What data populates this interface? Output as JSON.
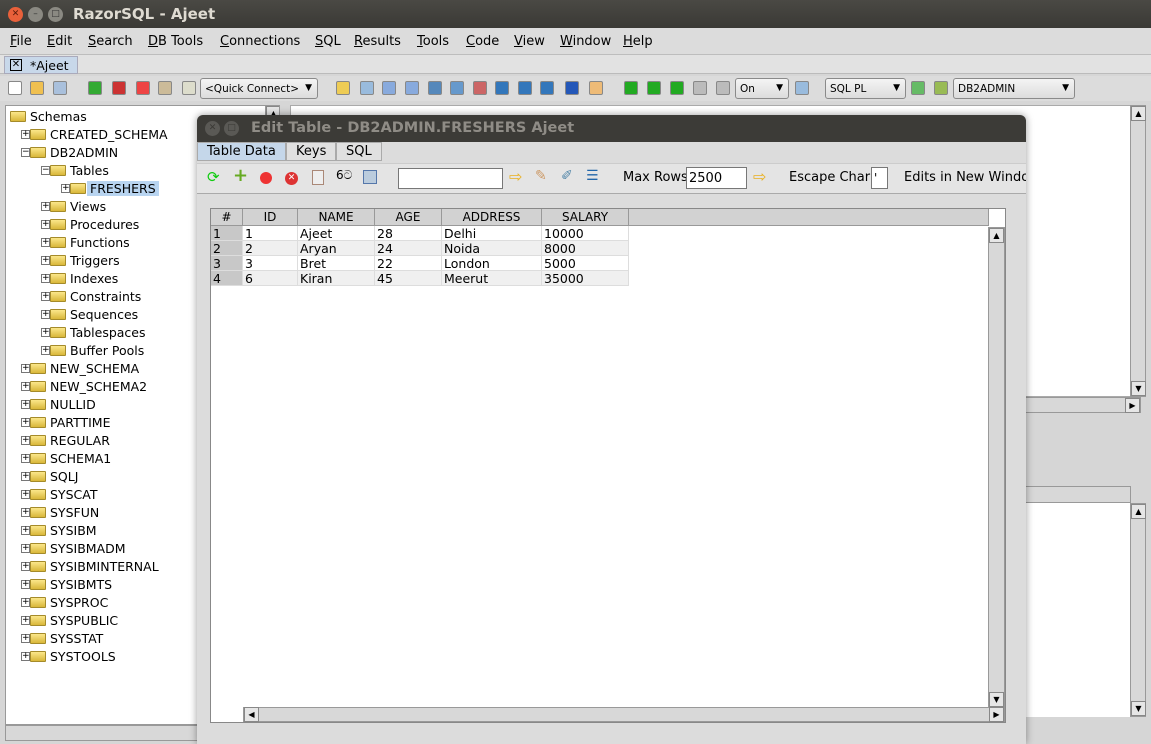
{
  "window": {
    "title": "RazorSQL - Ajeet"
  },
  "menu": [
    "File",
    "Edit",
    "Search",
    "DB Tools",
    "Connections",
    "SQL",
    "Results",
    "Tools",
    "Code",
    "View",
    "Window",
    "Help"
  ],
  "tab": {
    "label": "*Ajeet"
  },
  "toolbar": {
    "quick_connect": "<Quick Connect>",
    "autocommit": "On",
    "language": "SQL PL",
    "schema": "DB2ADMIN"
  },
  "tree": {
    "root": "Schemas",
    "items": [
      {
        "label": "CREATED_SCHEMA",
        "level": 1,
        "expanded": false
      },
      {
        "label": "DB2ADMIN",
        "level": 1,
        "expanded": true
      },
      {
        "label": "Tables",
        "level": 2,
        "expanded": true
      },
      {
        "label": "FRESHERS",
        "level": 3,
        "expanded": false,
        "selected": true
      },
      {
        "label": "Views",
        "level": 2,
        "expanded": false
      },
      {
        "label": "Procedures",
        "level": 2,
        "expanded": false
      },
      {
        "label": "Functions",
        "level": 2,
        "expanded": false
      },
      {
        "label": "Triggers",
        "level": 2,
        "expanded": false
      },
      {
        "label": "Indexes",
        "level": 2,
        "expanded": false
      },
      {
        "label": "Constraints",
        "level": 2,
        "expanded": false
      },
      {
        "label": "Sequences",
        "level": 2,
        "expanded": false
      },
      {
        "label": "Tablespaces",
        "level": 2,
        "expanded": false
      },
      {
        "label": "Buffer Pools",
        "level": 2,
        "expanded": false
      },
      {
        "label": "NEW_SCHEMA",
        "level": 1,
        "expanded": false
      },
      {
        "label": "NEW_SCHEMA2",
        "level": 1,
        "expanded": false
      },
      {
        "label": "NULLID",
        "level": 1,
        "expanded": false
      },
      {
        "label": "PARTTIME",
        "level": 1,
        "expanded": false
      },
      {
        "label": "REGULAR",
        "level": 1,
        "expanded": false
      },
      {
        "label": "SCHEMA1",
        "level": 1,
        "expanded": false
      },
      {
        "label": "SQLJ",
        "level": 1,
        "expanded": false
      },
      {
        "label": "SYSCAT",
        "level": 1,
        "expanded": false
      },
      {
        "label": "SYSFUN",
        "level": 1,
        "expanded": false
      },
      {
        "label": "SYSIBM",
        "level": 1,
        "expanded": false
      },
      {
        "label": "SYSIBMADM",
        "level": 1,
        "expanded": false
      },
      {
        "label": "SYSIBMINTERNAL",
        "level": 1,
        "expanded": false
      },
      {
        "label": "SYSIBMTS",
        "level": 1,
        "expanded": false
      },
      {
        "label": "SYSPROC",
        "level": 1,
        "expanded": false
      },
      {
        "label": "SYSPUBLIC",
        "level": 1,
        "expanded": false
      },
      {
        "label": "SYSSTAT",
        "level": 1,
        "expanded": false
      },
      {
        "label": "SYSTOOLS",
        "level": 1,
        "expanded": false
      }
    ]
  },
  "dialog": {
    "title": "Edit Table - DB2ADMIN.FRESHERS Ajeet",
    "tabs": [
      "Table Data",
      "Keys",
      "SQL"
    ],
    "active_tab": "Table Data",
    "filter_value": "",
    "max_rows_label": "Max Rows",
    "max_rows": "2500",
    "escape_char_label": "Escape Char",
    "escape_char": "'",
    "edits_new_window": "Edits in New Window",
    "columns": [
      "#",
      "ID",
      "NAME",
      "AGE",
      "ADDRESS",
      "SALARY"
    ],
    "rows": [
      [
        "1",
        "1",
        "Ajeet",
        "28",
        "Delhi",
        "10000"
      ],
      [
        "2",
        "2",
        "Aryan",
        "24",
        "Noida",
        "8000"
      ],
      [
        "3",
        "3",
        "Bret",
        "22",
        "London",
        "5000"
      ],
      [
        "4",
        "6",
        "Kiran",
        "45",
        "Meerut",
        "35000"
      ]
    ]
  }
}
